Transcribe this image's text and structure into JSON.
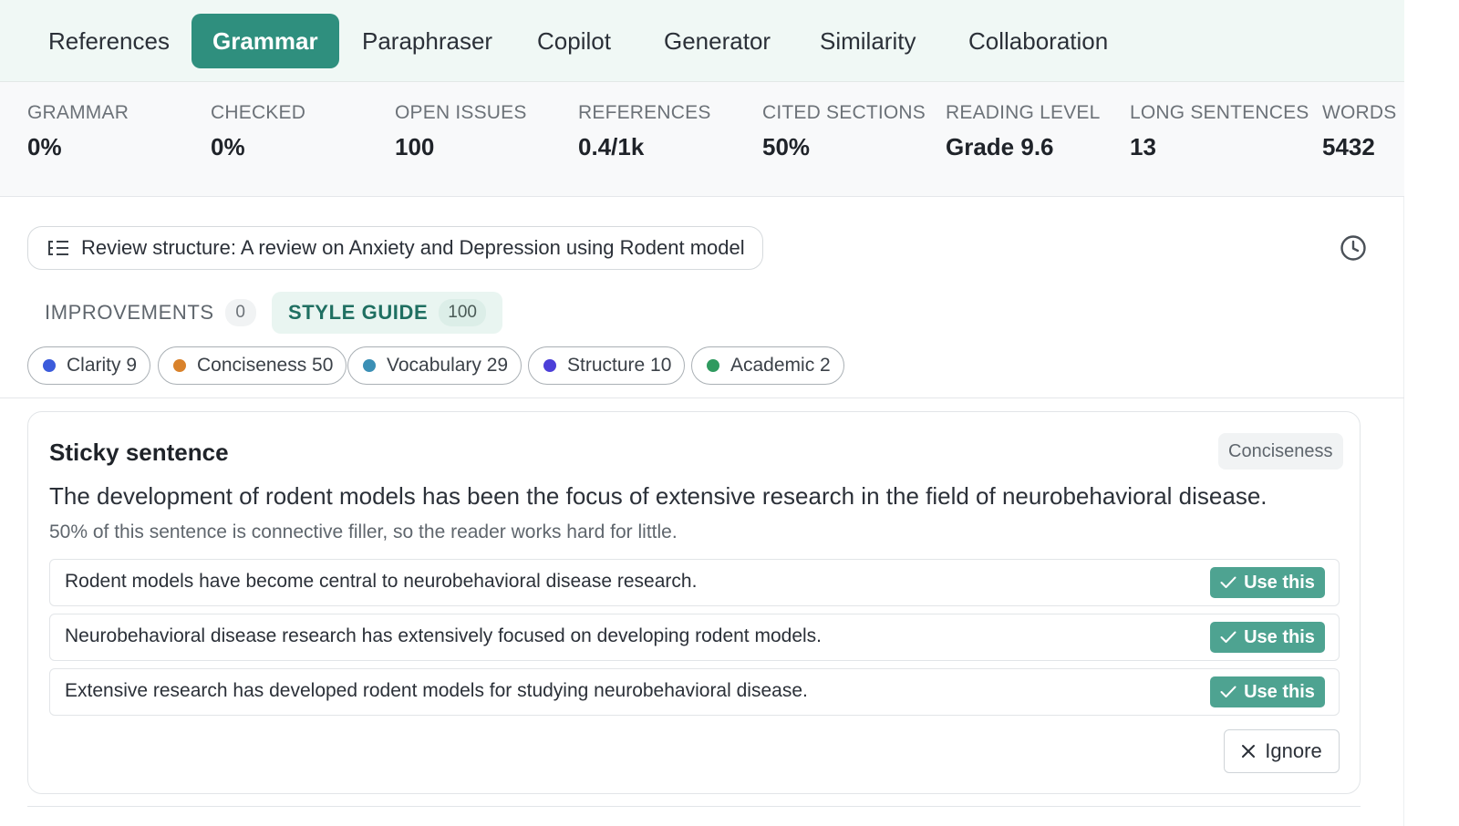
{
  "tabs": [
    {
      "label": "References",
      "active": false
    },
    {
      "label": "Grammar",
      "active": true
    },
    {
      "label": "Paraphraser",
      "active": false
    },
    {
      "label": "Copilot",
      "active": false
    },
    {
      "label": "Generator",
      "active": false
    },
    {
      "label": "Similarity",
      "active": false
    },
    {
      "label": "Collaboration",
      "active": false
    }
  ],
  "stats": [
    {
      "label": "GRAMMAR",
      "value": "0%"
    },
    {
      "label": "CHECKED",
      "value": "0%"
    },
    {
      "label": "OPEN ISSUES",
      "value": "100"
    },
    {
      "label": "REFERENCES",
      "value": "0.4/1k"
    },
    {
      "label": "CITED SECTIONS",
      "value": "50%"
    },
    {
      "label": "READING LEVEL",
      "value": "Grade 9.6"
    },
    {
      "label": "LONG SENTENCES",
      "value": "13"
    },
    {
      "label": "WORDS",
      "value": "5432"
    }
  ],
  "review": {
    "label": "Review structure: A review on Anxiety and Depression using Rodent model",
    "icon": "structure-list-icon",
    "history_icon": "clock-icon"
  },
  "sections": [
    {
      "label": "IMPROVEMENTS",
      "count": "0",
      "active": false
    },
    {
      "label": "STYLE GUIDE",
      "count": "100",
      "active": true
    }
  ],
  "filters": [
    {
      "label": "Clarity 9",
      "color": "#3b5bdb"
    },
    {
      "label": "Conciseness 50",
      "color": "#d9822b"
    },
    {
      "label": "Vocabulary 29",
      "color": "#3b8fb5"
    },
    {
      "label": "Structure 10",
      "color": "#4c3fd8"
    },
    {
      "label": "Academic 2",
      "color": "#2f9a5f"
    }
  ],
  "card": {
    "title": "Sticky sentence",
    "tag": "Conciseness",
    "sentence": "The development of rodent models has been the focus of extensive research in the field of neurobehavioral disease.",
    "note": "50% of this sentence is connective filler, so the reader works hard for little.",
    "suggestions": [
      {
        "text": "Rodent models have become central to neurobehavioral disease research.",
        "button": "Use this"
      },
      {
        "text": "Neurobehavioral disease research has extensively focused on developing rodent models.",
        "button": "Use this"
      },
      {
        "text": "Extensive research has developed rodent models for studying neurobehavioral disease.",
        "button": "Use this"
      }
    ],
    "ignore_label": "Ignore"
  },
  "colors": {
    "accent": "#2f8f7e",
    "use_button": "#4ea391"
  }
}
